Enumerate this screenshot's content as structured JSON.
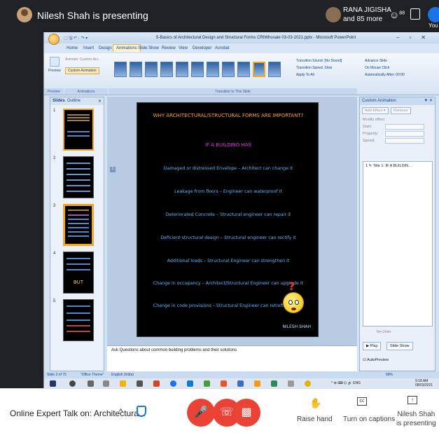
{
  "meet_top": {
    "presenter_text": "Nilesh Shah is presenting",
    "attendee_name": "RANA JIGISHA",
    "attendee_more": "and 85 more",
    "people_count": "88",
    "you_label": "You"
  },
  "ppt": {
    "qat": "⬚ 🖫 ↶ · ↷ ▾",
    "window_title": "5-Basics of Architectural Design and Structural Forms CRIWhosale 03-03-2021.pptx - Microsoft PowerPoint",
    "window_controls": "–▫✕",
    "tabs": [
      "Home",
      "Insert",
      "Design",
      "Animations",
      "Slide Show",
      "Review",
      "View",
      "Developer",
      "Acrobat"
    ],
    "active_tab": "Animations",
    "ribbon": {
      "preview_label": "Preview",
      "animate_label": "Animate: Custom Ani...",
      "custom_animation_label": "Custom Animation",
      "preview_group": "Preview",
      "animations_group": "Animations",
      "transition_group": "Transition to This Slide",
      "transition_sound": "Transition Sound: [No Sound]",
      "transition_speed": "Transition Speed: Slow",
      "apply_to_all": "Apply To All",
      "advance_slide": "Advance Slide",
      "on_mouse_click": "On Mouse Click",
      "automatically_after": "Automatically After: 00:00"
    },
    "panel_tabs": [
      "Slides",
      "Outline"
    ],
    "panel_close": "✕",
    "slide_numbers": [
      "1",
      "2",
      "3",
      "4",
      "5"
    ],
    "thumb4_text": "BUT",
    "slide": {
      "heading": "WHY ARCHITECTURAL/STRUCTURAL FORMS ARE IMPORTANT?",
      "subheading": "IF A BUILDING HAS",
      "lines": [
        "Damaged or distressed Envelope – Architect can change it",
        "Leakage from floors – Engineer can waterproof it",
        "Deteriorated Concrete – Structural engineer can repair it",
        "Deficient structural design – Structural engineer can rectify it",
        "Additional loads – Structural Engineer can strengthen it",
        "Change in occupancy – Architect/Structural Engineer can upgrade it",
        "Change in code provisions – Structural Engineer can retrofit it"
      ],
      "signature": "NILESH SHAH"
    },
    "notes_text": "Ask Questions about common building problems and their solutions",
    "task_pane": {
      "title": "Custom Animation",
      "add_effect": "Add Effect ▾",
      "remove": "Remove",
      "modify_label": "Modify effect",
      "rows": [
        "Start:",
        "Property:",
        "Speed:"
      ],
      "list_item": "1 ✎ Title 1: IF A BUILDIN...",
      "reorder": "Re-Order",
      "play": "▶ Play",
      "slide_show": "Slide Show",
      "autopreview": "AutoPreview"
    },
    "status": {
      "slide_of": "Slide 3 of 75",
      "theme": "\"Office Theme\"",
      "language": "English (India)",
      "zoom": "68%"
    },
    "taskbar": {
      "tray": "^ ⊕ ⌨ ⊡ 🔊 ENG",
      "time": "9:18 AM",
      "date": "08/03/2021"
    }
  },
  "meet_bottom": {
    "meeting_title": "Online Expert Talk on: Architectura...",
    "raise_hand": "Raise hand",
    "captions": "Turn on captions",
    "presenting_name": "Nilesh Shah",
    "presenting_label": "is presenting"
  },
  "colors": {
    "meet_dark": "#202124",
    "end_call_red": "#ea4335",
    "slide_heading": "#ff9a3c",
    "slide_sub": "#e03ce8",
    "slide_text": "#5db8ff"
  }
}
